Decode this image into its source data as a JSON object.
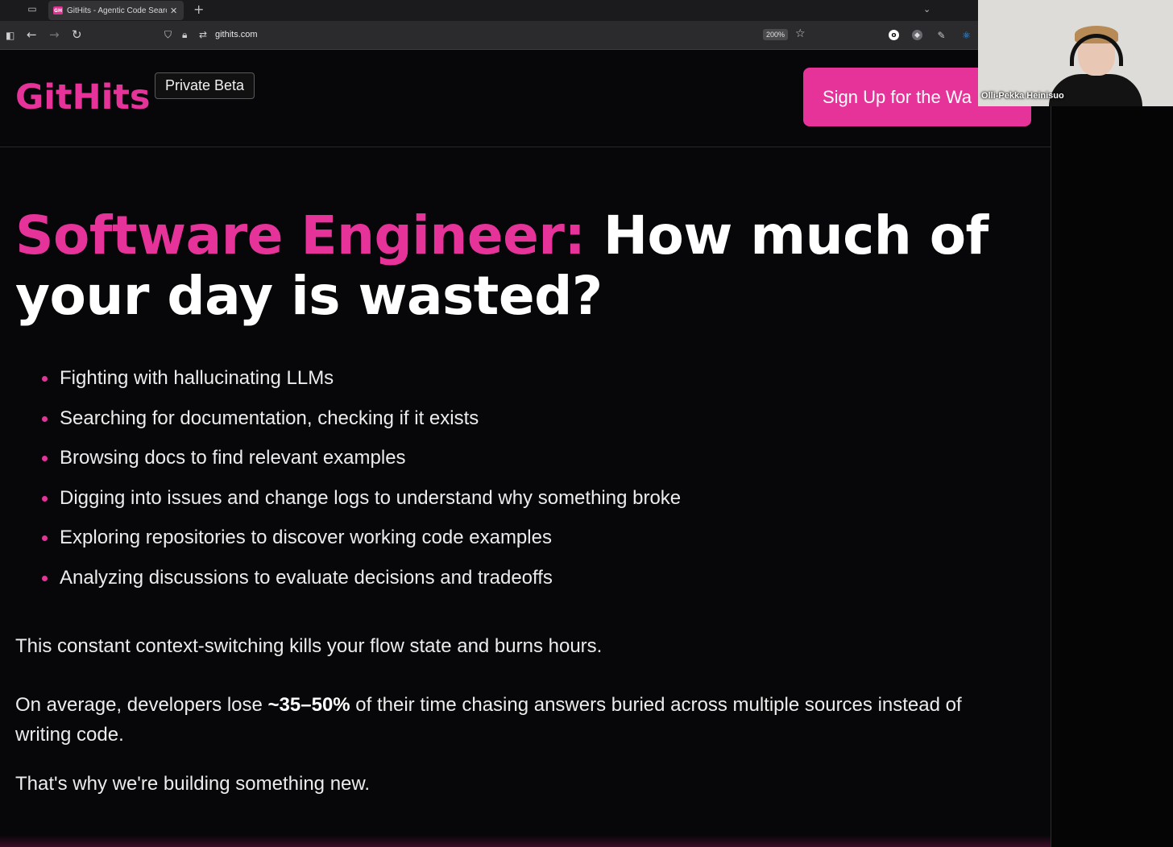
{
  "browser": {
    "tab_title": "GitHits - Agentic Code Search f",
    "tab_favicon": "GH",
    "url": "githits.com",
    "zoom": "200%"
  },
  "header": {
    "logo": "GitHits",
    "badge": "Private Beta",
    "cta_label": "Sign Up for the Wa"
  },
  "hero": {
    "headline_accent": "Software Engineer:",
    "headline_rest": " How much of your day is wasted?"
  },
  "bullets": [
    "Fighting with hallucinating LLMs",
    "Searching for documentation, checking if it exists",
    "Browsing docs to find relevant examples",
    "Digging into issues and change logs to understand why something broke",
    "Exploring repositories to discover working code examples",
    "Analyzing discussions to evaluate decisions and tradeoffs"
  ],
  "paragraphs": {
    "p1": "This constant context-switching kills your flow state and burns hours.",
    "p2_before": "On average, developers lose ",
    "p2_bold": "~35–50%",
    "p2_after": " of their time chasing answers buried across multiple sources instead of writing code.",
    "p3": "That's why we're building something new."
  },
  "video": {
    "participant_name": "Olli-Pekka Heinisuo"
  },
  "colors": {
    "accent": "#e6339a",
    "background": "#070608",
    "text": "#ececec"
  },
  "icons": {
    "tab_list": "tab-list-icon",
    "back": "back-arrow-icon",
    "forward": "forward-arrow-icon",
    "reload": "reload-icon",
    "shield": "shield-icon",
    "lock": "lock-icon",
    "permissions": "permissions-icon",
    "bookmark": "star-icon"
  }
}
